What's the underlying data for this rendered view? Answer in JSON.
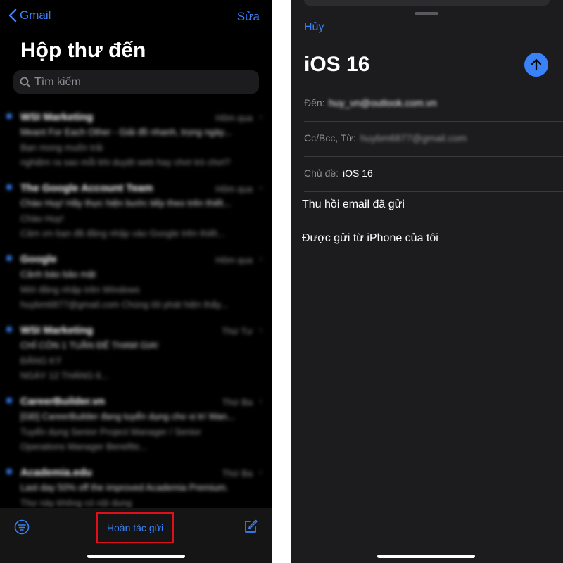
{
  "inbox": {
    "back_label": "Gmail",
    "edit_label": "Sửa",
    "title": "Hộp thư đến",
    "search_placeholder": "Tìm kiếm",
    "emails": [
      {
        "sender": "WSI Marketing",
        "date": "Hôm qua",
        "subject": "Meant For Each Other - Giải đồ nhanh, trọng ngày...",
        "preview1": "Bạn mong muốn trải",
        "preview2": "nghiệm ra sao mỗi khi duyệt web hay chơi trò chơi?"
      },
      {
        "sender": "The Google Account Team",
        "date": "Hôm qua",
        "subject": "Chào Huy! Hãy thực hiện bước tiếp theo trên thiết...",
        "preview1": "Chào Huy!",
        "preview2": "Cảm ơn bạn đã đăng nhập vào Google trên thiết..."
      },
      {
        "sender": "Google",
        "date": "Hôm qua",
        "subject": "Cảnh báo bảo mật",
        "preview1": "Mới đăng nhập trên Windows",
        "preview2": "huybm6877@gmail.com Chúng tôi phát hiện thấy..."
      },
      {
        "sender": "WSI Marketing",
        "date": "Thứ Tư",
        "subject": "CHỈ CÒN 1 TUẦN ĐỂ THAM GIA!",
        "preview1": "ĐĂNG KÝ",
        "preview2": "NGÀY 12 THÁNG 6..."
      },
      {
        "sender": "CareerBuilder.vn",
        "date": "Thứ Ba",
        "subject": "[GĐ] CareerBuilder đang tuyển dụng cho vị trí Wan...",
        "preview1": "Tuyển dụng Senior Project Manager / Senior",
        "preview2": "Operations Manager Benefits..."
      },
      {
        "sender": "Academia.edu",
        "date": "Thứ Ba",
        "subject": "Last day 50% off the improved Academia Premium.",
        "preview1": "Thư này không có nội dung",
        "preview2": ""
      }
    ],
    "undo_send_label": "Hoàn tác gửi"
  },
  "compose": {
    "cancel_label": "Hủy",
    "title": "iOS 16",
    "to_label": "Đến:",
    "to_value": "huy_vn@outlook.com.vn",
    "ccbcc_label": "Cc/Bcc, Từ:",
    "ccbcc_value": "huybm6877@gmail.com",
    "subject_label": "Chủ đề:",
    "subject_value": "iOS 16",
    "body_line1": "Thu hồi email đã gửi",
    "body_line2": "Được gửi từ iPhone của tôi"
  },
  "colors": {
    "accent": "#3a82f7",
    "highlight_box": "#e0101a",
    "background": "#000000",
    "sheet": "#1c1c1e"
  },
  "icons": [
    "chevron-left-icon",
    "search-icon",
    "filter-icon",
    "compose-icon",
    "arrow-up-icon"
  ]
}
